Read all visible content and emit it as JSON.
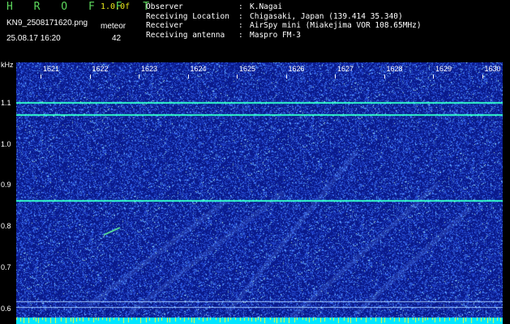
{
  "header": {
    "brand": "H R O F F T",
    "version": "1.0.0f",
    "filename": "KN9_2508171620.png",
    "timestamp": "25.08.17 16:20",
    "meteor_label": "meteor",
    "meteor_count": "42"
  },
  "info": {
    "rows": [
      {
        "key": "Observer",
        "sep": ":",
        "value": "K.Nagai"
      },
      {
        "key": "Receiving Location",
        "sep": ":",
        "value": "Chigasaki, Japan (139.414 35.340)"
      },
      {
        "key": "Receiver",
        "sep": ":",
        "value": "AirSpy mini (Miakejima VOR 108.65MHz)"
      },
      {
        "key": "Receiving antenna",
        "sep": ":",
        "value": "Maspro FM-3"
      }
    ]
  },
  "chart_data": {
    "type": "heatmap",
    "ylabel": "kHz",
    "x_ticks": [
      "1621",
      "1622",
      "1623",
      "1624",
      "1625",
      "1626",
      "1627",
      "1628",
      "1629",
      "1630"
    ],
    "y_ticks": [
      "1.1",
      "1.0",
      "0.9",
      "0.8",
      "0.7",
      "0.6"
    ],
    "ylim": [
      0.58,
      1.2
    ],
    "carrier_lines_khz": [
      1.103,
      1.075,
      0.865,
      0.62,
      0.605
    ],
    "colors": {
      "background": "#0a1a8c",
      "noise": "#3a6dff",
      "carrier": "#33ffcc",
      "bottom_band": "#00e5ff",
      "bottom_marks": "#ffff33"
    }
  }
}
